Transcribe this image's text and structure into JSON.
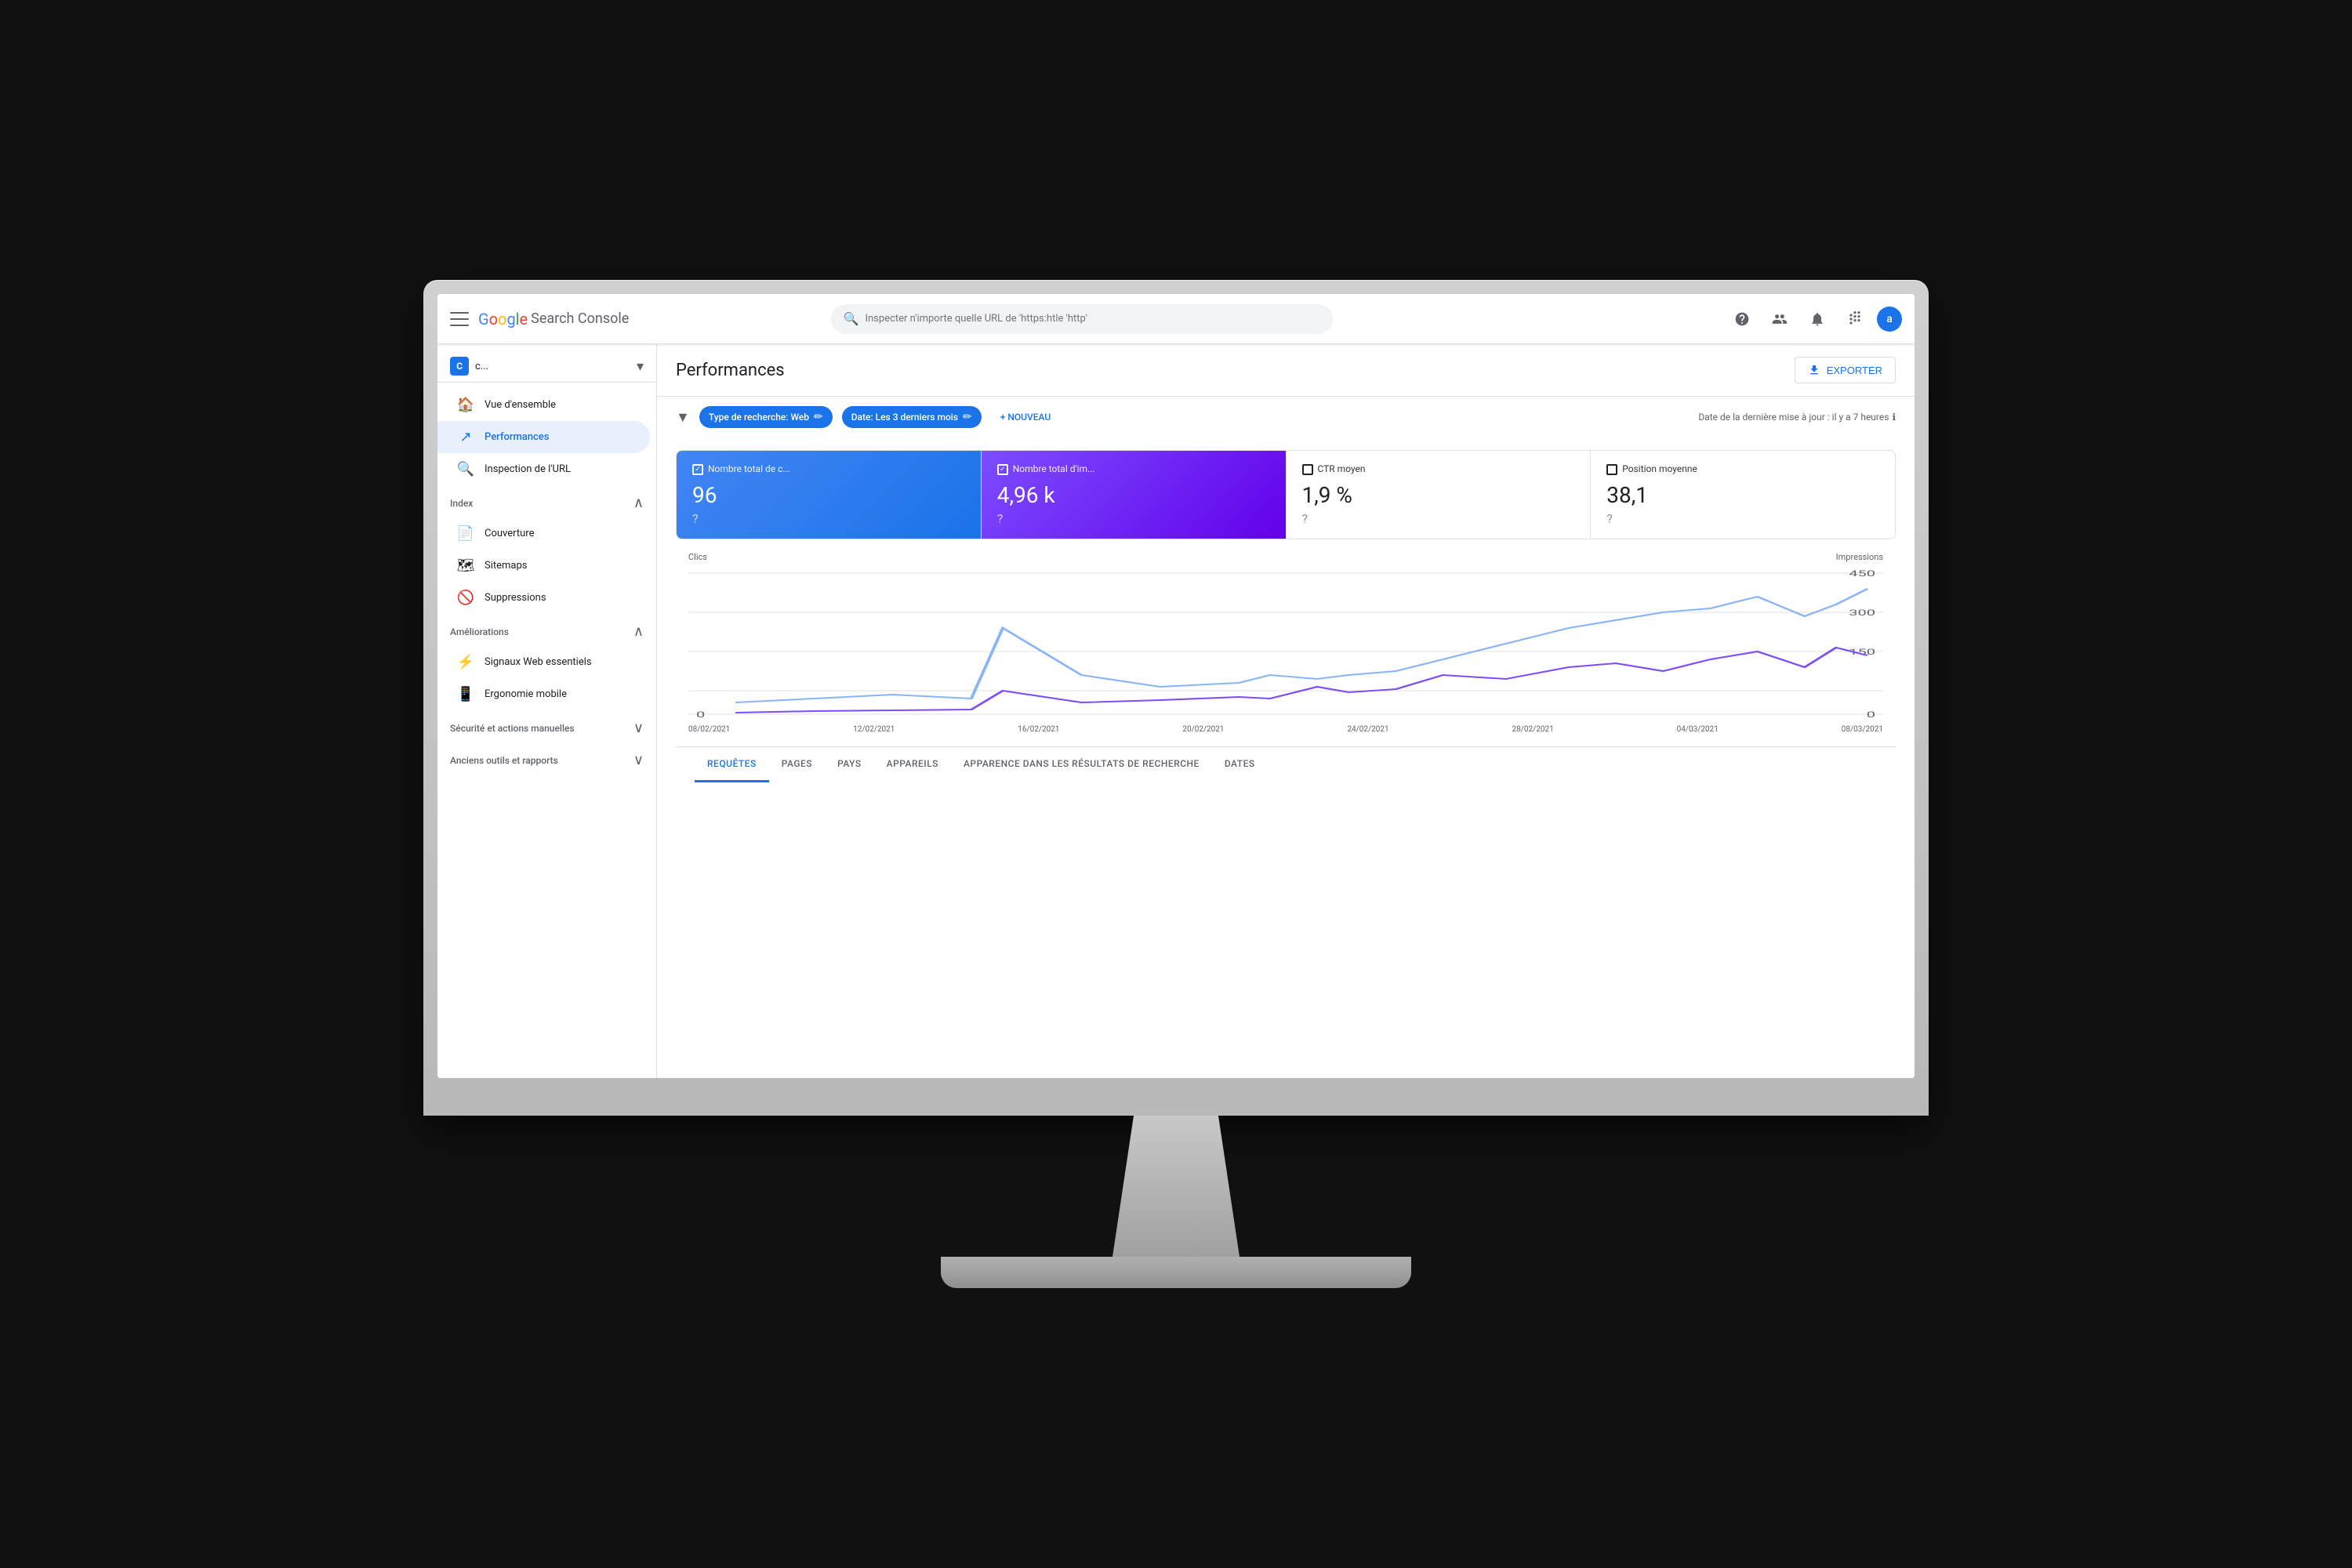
{
  "app": {
    "title": "Google Search Console",
    "logo": {
      "google": "Google",
      "search_console": "Search Console"
    }
  },
  "navbar": {
    "menu_icon": "menu",
    "search_placeholder": "Inspecter n'importe quelle URL de 'https:htle 'http'",
    "help_icon": "?",
    "accounts_icon": "person",
    "notifications_icon": "bell",
    "apps_icon": "grid",
    "avatar_label": "a"
  },
  "sidebar": {
    "property": {
      "label": "c...",
      "icon": "C"
    },
    "items": [
      {
        "id": "vue-ensemble",
        "label": "Vue d'ensemble",
        "icon": "🏠",
        "active": false
      },
      {
        "id": "performances",
        "label": "Performances",
        "icon": "↗",
        "active": true
      },
      {
        "id": "inspection-url",
        "label": "Inspection de l'URL",
        "icon": "🔍",
        "active": false
      }
    ],
    "sections": [
      {
        "id": "index",
        "label": "Index",
        "expanded": true,
        "items": [
          {
            "id": "couverture",
            "label": "Couverture",
            "icon": "📄"
          },
          {
            "id": "sitemaps",
            "label": "Sitemaps",
            "icon": "🗺"
          },
          {
            "id": "suppressions",
            "label": "Suppressions",
            "icon": "🚫"
          }
        ]
      },
      {
        "id": "ameliorations",
        "label": "Améliorations",
        "expanded": true,
        "items": [
          {
            "id": "signaux-web",
            "label": "Signaux Web essentiels",
            "icon": "⚡"
          },
          {
            "id": "ergonomie-mobile",
            "label": "Ergonomie mobile",
            "icon": "📱"
          }
        ]
      },
      {
        "id": "securite",
        "label": "Sécurité et actions manuelles",
        "expanded": false,
        "items": []
      },
      {
        "id": "anciens-outils",
        "label": "Anciens outils et rapports",
        "expanded": false,
        "items": []
      }
    ]
  },
  "main": {
    "title": "Performances",
    "export_label": "EXPORTER",
    "filters": {
      "filter_icon": "funnel",
      "chips": [
        {
          "label": "Type de recherche: Web",
          "active": true
        },
        {
          "label": "Date: Les 3 derniers mois",
          "active": true
        }
      ],
      "add_label": "+ NOUVEAU",
      "update_text": "Date de la dernière mise à jour : il y a 7 heures",
      "info_icon": "?"
    },
    "metrics": [
      {
        "id": "clics",
        "label": "Nombre total de c...",
        "value": "96",
        "active": true,
        "color": "blue"
      },
      {
        "id": "impressions",
        "label": "Nombre total d'im...",
        "value": "4,96 k",
        "active": true,
        "color": "purple"
      },
      {
        "id": "ctr",
        "label": "CTR moyen",
        "value": "1,9 %",
        "active": false,
        "color": "none"
      },
      {
        "id": "position",
        "label": "Position moyenne",
        "value": "38,1",
        "active": false,
        "color": "none"
      }
    ],
    "chart": {
      "left_label": "Clics",
      "right_label": "Impressions",
      "right_scale": [
        "450",
        "300",
        "150",
        "0"
      ],
      "left_scale": [
        "0"
      ],
      "x_labels": [
        "08/02/2021",
        "12/02/2021",
        "16/02/2021",
        "20/02/2021",
        "24/02/2021",
        "28/02/2021",
        "04/03/2021",
        "08/03/2021"
      ]
    },
    "tabs": [
      {
        "id": "requetes",
        "label": "REQUÊTES",
        "active": true
      },
      {
        "id": "pages",
        "label": "PAGES",
        "active": false
      },
      {
        "id": "pays",
        "label": "PAYS",
        "active": false
      },
      {
        "id": "appareils",
        "label": "APPAREILS",
        "active": false
      },
      {
        "id": "apparence",
        "label": "APPARENCE DANS LES RÉSULTATS DE RECHERCHE",
        "active": false
      },
      {
        "id": "dates",
        "label": "DATES",
        "active": false
      }
    ]
  },
  "imac": {
    "apple_logo": ""
  }
}
